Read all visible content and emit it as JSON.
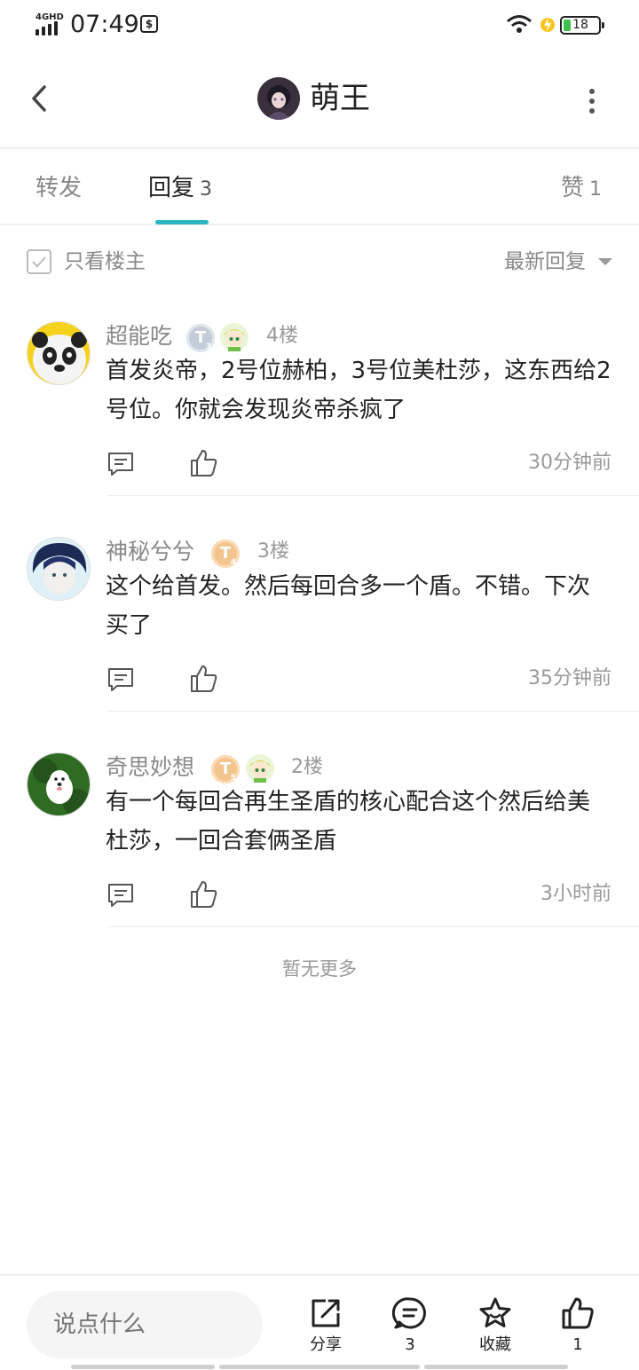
{
  "status_bar": {
    "network": "4GHD",
    "time": "07:49",
    "battery": "18",
    "battery_level": 0.18
  },
  "header": {
    "title": "萌王"
  },
  "tabs": [
    {
      "label": "转发",
      "count": ""
    },
    {
      "label": "回复",
      "count": "3"
    },
    {
      "label": "赞",
      "count": "1"
    }
  ],
  "filter": {
    "only_op_label": "只看楼主",
    "sort_label": "最新回复"
  },
  "comments": [
    {
      "name": "超能吃",
      "badge": "T",
      "badge_level": "3",
      "floor": "4楼",
      "text": "首发炎帝，2号位赫柏，3号位美杜莎，这东西给2号位。你就会发现炎帝杀疯了",
      "time": "30分钟前"
    },
    {
      "name": "神秘兮兮",
      "badge": "T",
      "badge_level": "4",
      "floor": "3楼",
      "text": "这个给首发。然后每回合多一个盾。不错。下次买了",
      "time": "35分钟前"
    },
    {
      "name": "奇思妙想",
      "badge": "T",
      "badge_level": "5",
      "floor": "2楼",
      "text": "有一个每回合再生圣盾的核心配合这个然后给美杜莎，一回合套俩圣盾",
      "time": "3小时前"
    }
  ],
  "no_more": "暂无更多",
  "bottom_bar": {
    "input_placeholder": "说点什么",
    "share_label": "分享",
    "comment_count": "3",
    "favorite_label": "收藏",
    "like_count": "1"
  },
  "colors": {
    "accent": "#2bb6c2",
    "text_primary": "#222222",
    "text_secondary": "#888888"
  }
}
